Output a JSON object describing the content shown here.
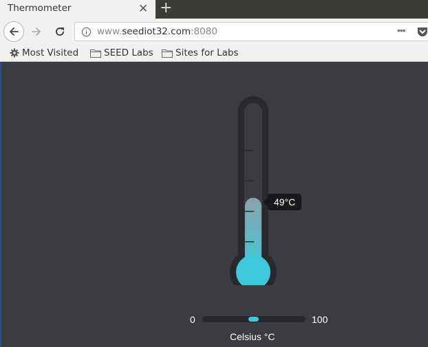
{
  "browser": {
    "tab": {
      "title": "Thermometer",
      "close_glyph": "✕"
    },
    "new_tab_glyph": "+",
    "url": {
      "prefix": "www.",
      "host": "seediot32.com",
      "port": ":8080"
    },
    "more_glyph": "•••",
    "bookmarks": [
      {
        "label": "Most Visited",
        "icon": "gear-icon"
      },
      {
        "label": "SEED Labs",
        "icon": "folder-icon"
      },
      {
        "label": "Sites for Labs",
        "icon": "folder-icon"
      }
    ]
  },
  "thermometer": {
    "value": 49,
    "min": 0,
    "max": 100,
    "readout": "49°C",
    "unit_label": "Celsius °C",
    "min_label": "0",
    "max_label": "100",
    "colors": {
      "mercury_top": "#8aa3a8",
      "mercury_bottom": "#3ec8dc",
      "tube": "#29292d",
      "accent": "#3ec8dc"
    }
  }
}
